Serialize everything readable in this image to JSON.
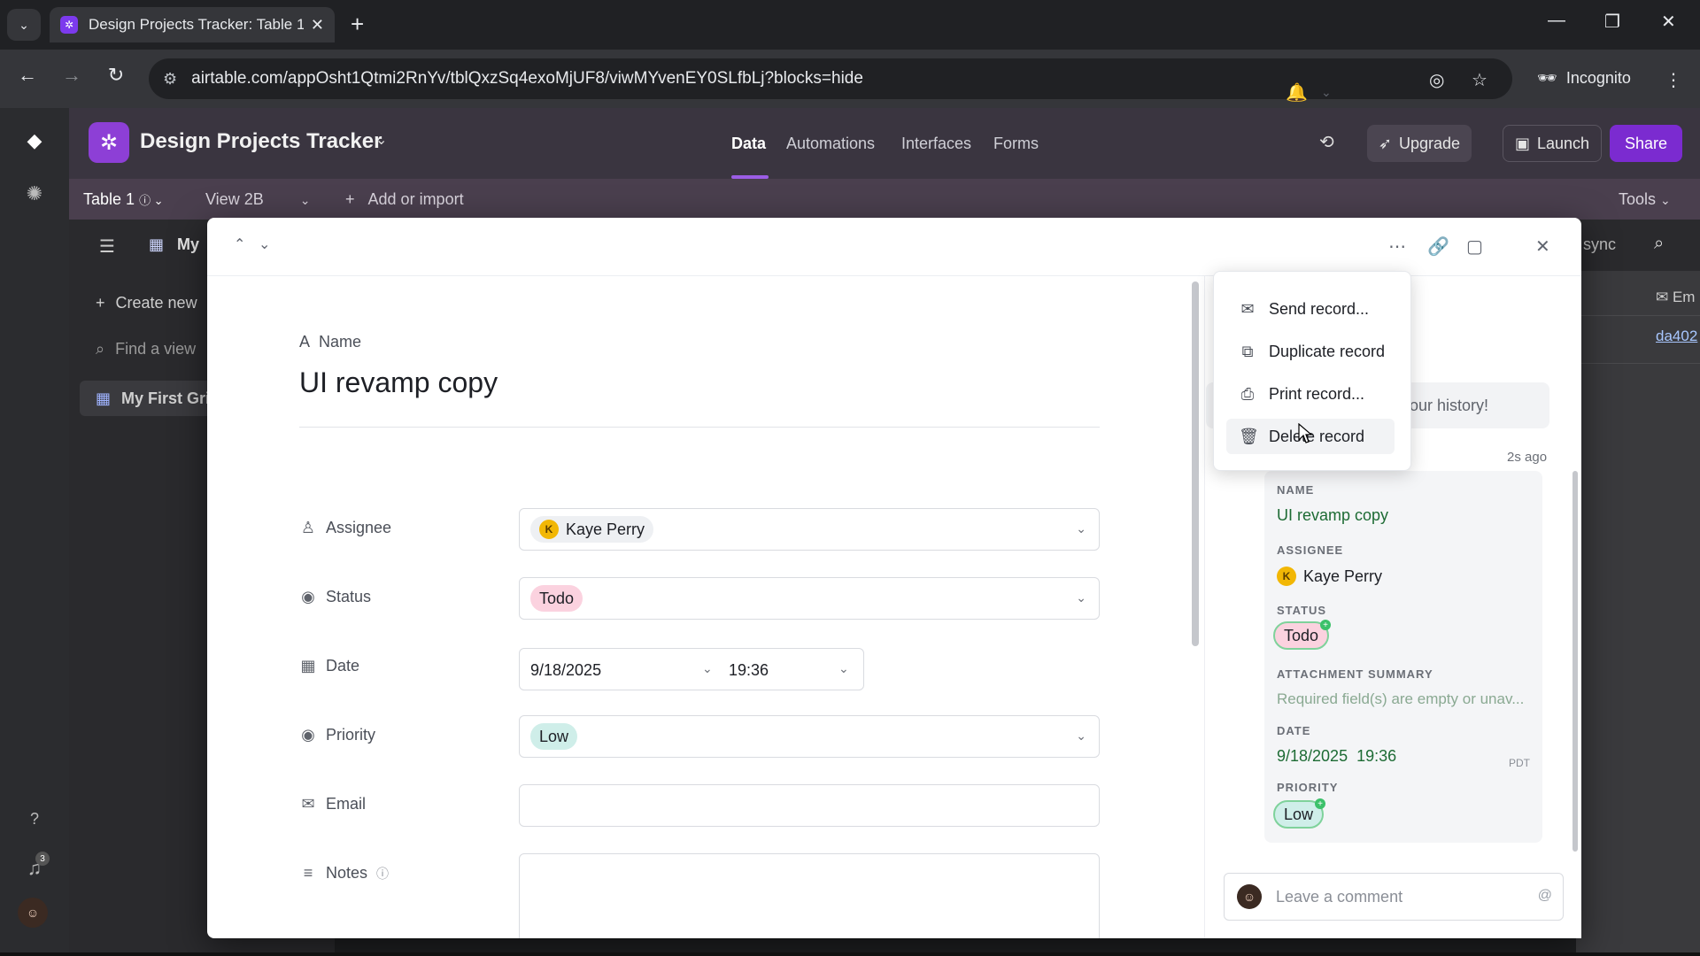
{
  "browser": {
    "tab_title": "Design Projects Tracker: Table 1",
    "url": "airtable.com/appOsht1Qtmi2RnYv/tblQxzSq4exoMjUF8/viwMYvenEY0SLfbLj?blocks=hide",
    "incognito_label": "Incognito"
  },
  "header": {
    "base_name": "Design Projects Tracker",
    "nav": [
      "Data",
      "Automations",
      "Interfaces",
      "Forms"
    ],
    "active_nav": "Data",
    "upgrade_label": "Upgrade",
    "launch_label": "Launch",
    "share_label": "Share",
    "accent_color": "#7b2bd0"
  },
  "tablebar": {
    "table_name": "Table 1",
    "view_name": "View 2B",
    "add_label": "Add or import",
    "tools_label": "Tools"
  },
  "viewbar": {
    "view_prefix": "My",
    "sync_label": "sync"
  },
  "sidebar": {
    "create_label": "Create new",
    "find_placeholder": "Find a view",
    "view_item": "My First Grid"
  },
  "grid": {
    "header": "Em",
    "cell_link": "da402"
  },
  "record": {
    "name_label": "Name",
    "title": "UI revamp copy",
    "fields": {
      "assignee_label": "Assignee",
      "assignee_value": "Kaye Perry",
      "assignee_initial": "K",
      "status_label": "Status",
      "status_value": "Todo",
      "date_label": "Date",
      "date_value": "9/18/2025",
      "time_value": "19:36",
      "priority_label": "Priority",
      "priority_value": "Low",
      "email_label": "Email",
      "email_value": "",
      "notes_label": "Notes",
      "notes_value": ""
    }
  },
  "history": {
    "banner_text": "our history!",
    "time_ago": "2s ago",
    "name_label": "NAME",
    "name_value": "UI revamp copy",
    "assignee_label": "ASSIGNEE",
    "assignee_value": "Kaye Perry",
    "status_label": "STATUS",
    "status_value": "Todo",
    "attachment_label": "ATTACHMENT SUMMARY",
    "attachment_value": "Required field(s) are empty or unav...",
    "date_label": "DATE",
    "date_value": "9/18/2025",
    "time_value": "19:36",
    "tz": "PDT",
    "priority_label": "PRIORITY",
    "priority_value": "Low",
    "comment_placeholder": "Leave a comment"
  },
  "menu": {
    "items": [
      {
        "label": "Send record...",
        "icon": "mail-icon"
      },
      {
        "label": "Duplicate record",
        "icon": "copy-icon"
      },
      {
        "label": "Print record...",
        "icon": "printer-icon"
      },
      {
        "label": "Delete record",
        "icon": "trash-icon"
      }
    ],
    "hovered_index": 3
  },
  "rail": {
    "notification_count": "3"
  }
}
